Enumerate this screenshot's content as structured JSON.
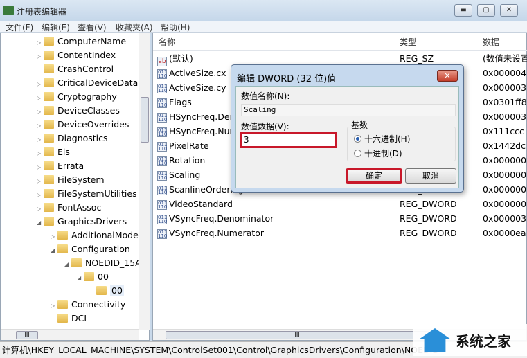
{
  "window": {
    "title": "注册表编辑器"
  },
  "menu": [
    "文件(F)",
    "编辑(E)",
    "查看(V)",
    "收藏夹(A)",
    "帮助(H)"
  ],
  "tree": [
    {
      "label": "ComputerName",
      "level": 0,
      "expander": "▷"
    },
    {
      "label": "ContentIndex",
      "level": 0,
      "expander": "▷"
    },
    {
      "label": "CrashControl",
      "level": 0,
      "expander": ""
    },
    {
      "label": "CriticalDeviceDatab",
      "level": 0,
      "expander": "▷"
    },
    {
      "label": "Cryptography",
      "level": 0,
      "expander": "▷"
    },
    {
      "label": "DeviceClasses",
      "level": 0,
      "expander": "▷"
    },
    {
      "label": "DeviceOverrides",
      "level": 0,
      "expander": "▷"
    },
    {
      "label": "Diagnostics",
      "level": 0,
      "expander": "▷"
    },
    {
      "label": "Els",
      "level": 0,
      "expander": "▷"
    },
    {
      "label": "Errata",
      "level": 0,
      "expander": "▷"
    },
    {
      "label": "FileSystem",
      "level": 0,
      "expander": "▷"
    },
    {
      "label": "FileSystemUtilities",
      "level": 0,
      "expander": "▷"
    },
    {
      "label": "FontAssoc",
      "level": 0,
      "expander": "▷"
    },
    {
      "label": "GraphicsDrivers",
      "level": 0,
      "expander": "◢"
    },
    {
      "label": "AdditionalMode",
      "level": 1,
      "expander": "▷"
    },
    {
      "label": "Configuration",
      "level": 1,
      "expander": "◢"
    },
    {
      "label": "NOEDID_15A",
      "level": 2,
      "expander": "◢"
    },
    {
      "label": "00",
      "level": 3,
      "expander": "◢"
    },
    {
      "label": "00",
      "level": 4,
      "expander": "",
      "selected": true
    },
    {
      "label": "Connectivity",
      "level": 1,
      "expander": "▷"
    },
    {
      "label": "DCI",
      "level": 1,
      "expander": ""
    }
  ],
  "columns": {
    "name": "名称",
    "type": "类型",
    "data": "数据"
  },
  "values": [
    {
      "name": "(默认)",
      "type": "REG_SZ",
      "data": "(数值未设置)",
      "icon": "string"
    },
    {
      "name": "ActiveSize.cx",
      "type": "REG_DWORD",
      "data": "0x000004",
      "icon": "binary"
    },
    {
      "name": "ActiveSize.cy",
      "type": "REG_DWORD",
      "data": "0x000003",
      "icon": "binary"
    },
    {
      "name": "Flags",
      "type": "REG_DWORD",
      "data": "0x0301ff8",
      "icon": "binary"
    },
    {
      "name": "HSyncFreq.Denominator",
      "type": "REG_DWORD",
      "data": "0x000003",
      "icon": "binary"
    },
    {
      "name": "HSyncFreq.Numerator",
      "type": "REG_DWORD",
      "data": "0x111ccc",
      "icon": "binary"
    },
    {
      "name": "PixelRate",
      "type": "REG_DWORD",
      "data": "0x1442dc",
      "icon": "binary"
    },
    {
      "name": "Rotation",
      "type": "REG_DWORD",
      "data": "0x000000",
      "icon": "binary"
    },
    {
      "name": "Scaling",
      "type": "REG_DWORD",
      "data": "0x000000",
      "icon": "binary"
    },
    {
      "name": "ScanlineOrdering",
      "type": "REG_DWORD",
      "data": "0x000000",
      "icon": "binary"
    },
    {
      "name": "VideoStandard",
      "type": "REG_DWORD",
      "data": "0x000000",
      "icon": "binary"
    },
    {
      "name": "VSyncFreq.Denominator",
      "type": "REG_DWORD",
      "data": "0x000003",
      "icon": "binary"
    },
    {
      "name": "VSyncFreq.Numerator",
      "type": "REG_DWORD",
      "data": "0x0000ea",
      "icon": "binary"
    }
  ],
  "status": "计算机\\HKEY_LOCAL_MACHINE\\SYSTEM\\ControlSet001\\Control\\GraphicsDrivers\\Configuration\\NOEDID",
  "dialog": {
    "title": "编辑 DWORD (32 位)值",
    "name_label": "数值名称(N):",
    "name_value": "Scaling",
    "data_label": "数值数据(V):",
    "data_value": "3",
    "base_label": "基数",
    "hex_label": "十六进制(H)",
    "dec_label": "十进制(D)",
    "base_selected": "hex",
    "ok": "确定",
    "cancel": "取消",
    "highlight_color": "#c8182a"
  },
  "watermark": {
    "text": "系统之家"
  }
}
